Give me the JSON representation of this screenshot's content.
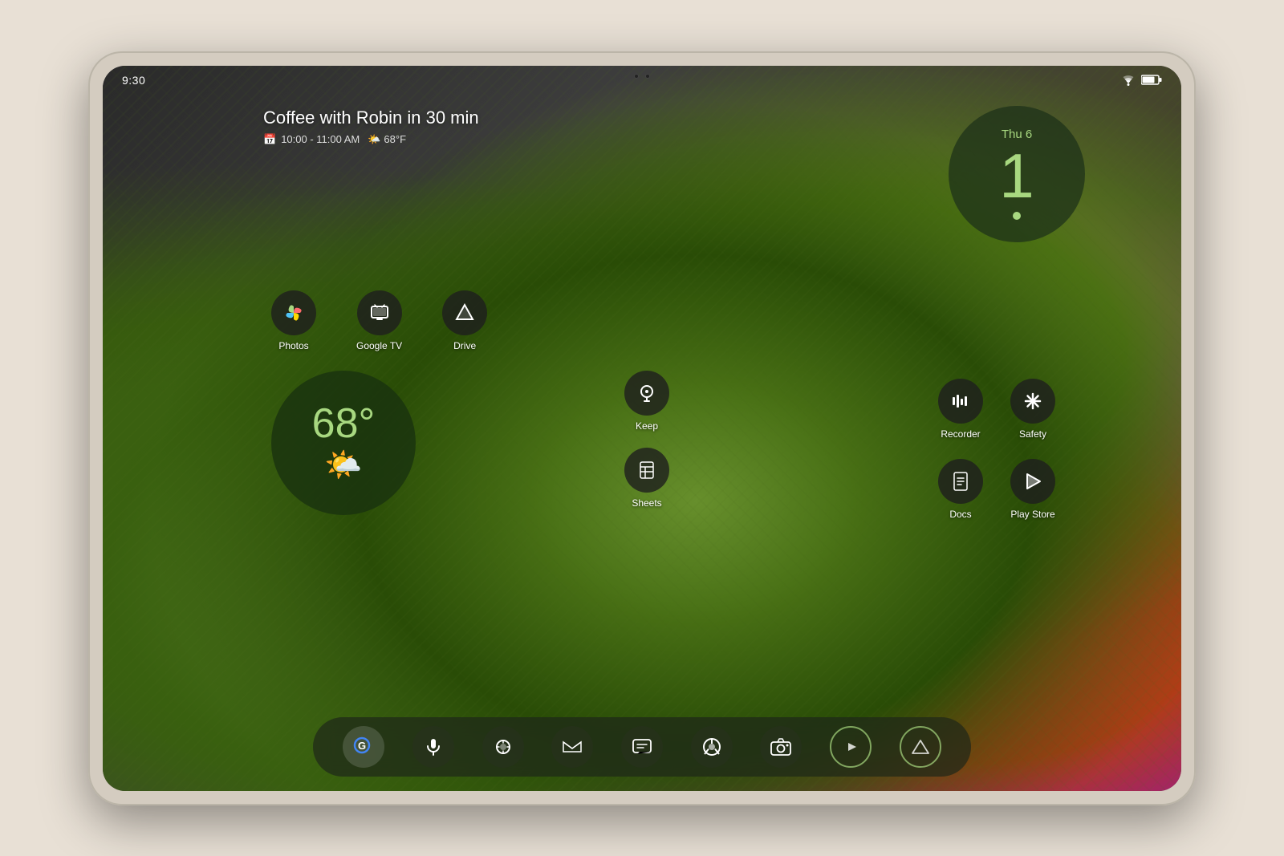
{
  "device": {
    "type": "tablet",
    "model": "Pixel Tablet"
  },
  "status_bar": {
    "time": "9:30",
    "wifi_signal": "full",
    "battery_level": 75
  },
  "calendar_widget": {
    "event_title": "Coffee with Robin in 30 min",
    "event_time": "10:00 - 11:00 AM",
    "event_weather": "68°F",
    "calendar_icon": "📅",
    "weather_icon": "🌤️"
  },
  "clock_widget": {
    "day": "Thu 6",
    "hour": "1",
    "dot_color": "#a8d880"
  },
  "weather_widget": {
    "temperature": "68°",
    "icon": "🌤️",
    "unit": "F"
  },
  "app_icons_row": [
    {
      "id": "photos",
      "label": "Photos",
      "icon": "photos"
    },
    {
      "id": "google-tv",
      "label": "Google TV",
      "icon": "tv"
    },
    {
      "id": "drive",
      "label": "Drive",
      "icon": "drive"
    }
  ],
  "center_apps": [
    {
      "id": "keep",
      "label": "Keep",
      "icon": "keep"
    },
    {
      "id": "sheets",
      "label": "Sheets",
      "icon": "sheets"
    }
  ],
  "right_app_grid": [
    {
      "id": "recorder",
      "label": "Recorder",
      "icon": "recorder"
    },
    {
      "id": "safety",
      "label": "Safety",
      "icon": "safety"
    },
    {
      "id": "docs",
      "label": "Docs",
      "icon": "docs"
    },
    {
      "id": "play-store",
      "label": "Play Store",
      "icon": "play-store"
    }
  ],
  "dock_apps": [
    {
      "id": "google-search",
      "label": "",
      "icon": "google"
    },
    {
      "id": "assistant-mic",
      "label": "",
      "icon": "mic"
    },
    {
      "id": "lens",
      "label": "",
      "icon": "lens"
    },
    {
      "id": "gmail",
      "label": "",
      "icon": "gmail"
    },
    {
      "id": "messages",
      "label": "",
      "icon": "messages"
    },
    {
      "id": "chrome",
      "label": "",
      "icon": "chrome"
    },
    {
      "id": "camera",
      "label": "",
      "icon": "camera"
    },
    {
      "id": "youtube",
      "label": "",
      "icon": "youtube"
    },
    {
      "id": "pixel-launcher",
      "label": "",
      "icon": "pixel"
    }
  ],
  "colors": {
    "accent_green": "#a8d880",
    "dark_bg": "#2a2a2a",
    "widget_bg": "rgba(25,50,15,0.8)",
    "dock_bg": "rgba(30,38,25,0.7)",
    "text_white": "#ffffff",
    "text_light": "#dddddd"
  }
}
